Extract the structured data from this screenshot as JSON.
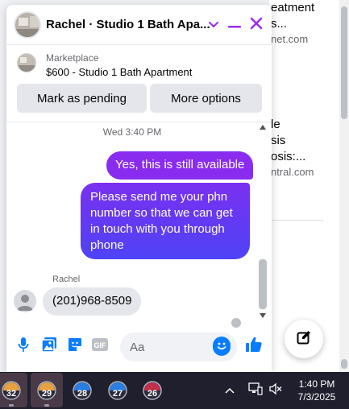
{
  "background": {
    "items": [
      {
        "title": "eatment",
        "line2": "s...",
        "sub": "net.com"
      },
      {
        "title": "le",
        "line2": "sis",
        "line3": "osis:...",
        "sub": "ntral.com"
      }
    ]
  },
  "chat": {
    "header_title": "Rachel · Studio 1 Bath Apa...",
    "marketplace_label": "Marketplace",
    "listing_title": "$600 - Studio 1 Bath Apartment",
    "btn_pending": "Mark as pending",
    "btn_more": "More options",
    "timestamp": "Wed 3:40 PM",
    "messages_out": [
      "Yes, this is still available",
      "Please send me your phn number so that we can get in touch with you through phone"
    ],
    "sender_name": "Rachel",
    "message_in": "(201)968-8509",
    "input_placeholder": "Aa"
  },
  "taskbar": {
    "apps": [
      {
        "badge": "32",
        "color": "#e8a040"
      },
      {
        "badge": "29",
        "color": "#e8a040"
      },
      {
        "badge": "28",
        "color": "#2a7de1"
      },
      {
        "badge": "27",
        "color": "#2a7de1"
      },
      {
        "badge": "26",
        "color": "#c0304a"
      }
    ],
    "time": "1:40 PM",
    "date": "7/3/2025"
  },
  "colors": {
    "accent_purple": "#8a2cf0",
    "accent_blue": "#0a7cff",
    "close_purple": "#9b2cf0"
  }
}
